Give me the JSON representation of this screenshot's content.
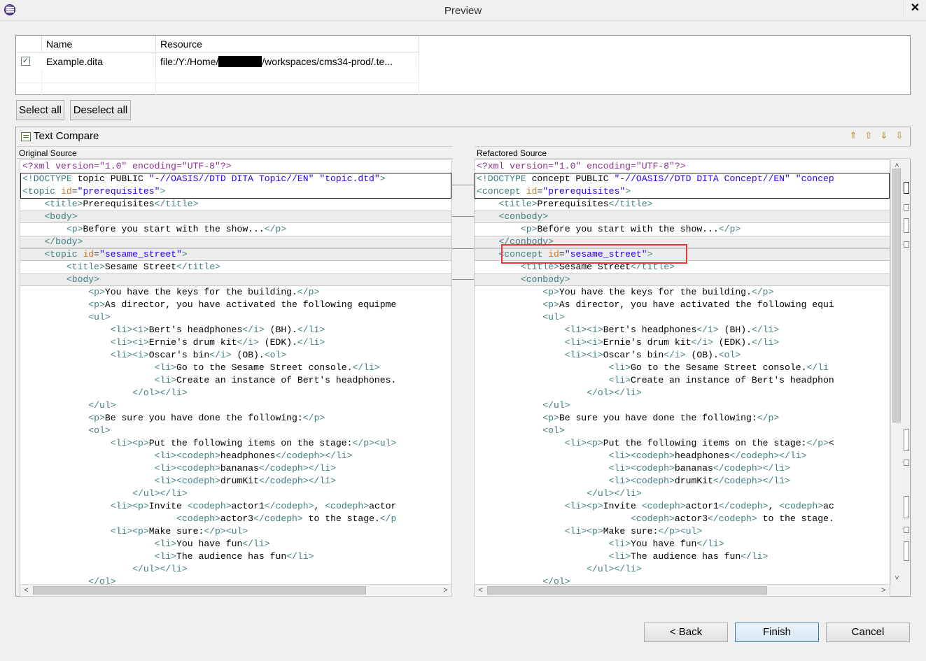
{
  "window": {
    "title": "Preview",
    "close_glyph": "✕"
  },
  "table": {
    "headers": {
      "name": "Name",
      "resource": "Resource"
    },
    "rows": [
      {
        "checked": true,
        "name": "Example.dita",
        "resource_prefix": "file:/Y:/Home/",
        "resource_suffix": "/workspaces/cms34-prod/.te..."
      }
    ]
  },
  "buttons": {
    "select_all": "Select all",
    "deselect_all": "Deselect all",
    "back": "< Back",
    "finish": "Finish",
    "cancel": "Cancel"
  },
  "compare": {
    "title": "Text Compare",
    "left_header": "Original Source",
    "right_header": "Refactored Source",
    "toolbar_icons": [
      "copy-all-left-to-right-icon",
      "copy-all-right-to-left-icon",
      "next-difference-icon",
      "previous-difference-icon"
    ]
  },
  "left_lines": [
    "<?xml version=\"1.0\" encoding=\"UTF-8\"?>",
    "<!DOCTYPE topic PUBLIC \"-//OASIS//DTD DITA Topic//EN\" \"topic.dtd\">",
    "<topic id=\"prerequisites\">",
    "    <title>Prerequisites</title>",
    "    <body>",
    "        <p>Before you start with the show...</p>",
    "    </body>",
    "    <topic id=\"sesame_street\">",
    "        <title>Sesame Street</title>",
    "        <body>",
    "            <p>You have the keys for the building.</p>",
    "            <p>As director, you have activated the following equipme",
    "            <ul>",
    "                <li><i>Bert's headphones</i> (BH).</li>",
    "                <li><i>Ernie's drum kit</i> (EDK).</li>",
    "                <li><i>Oscar's bin</i> (OB).<ol>",
    "                        <li>Go to the Sesame Street console.</li>",
    "                        <li>Create an instance of Bert's headphones.",
    "                    </ol></li>",
    "            </ul>",
    "            <p>Be sure you have done the following:</p>",
    "            <ol>",
    "                <li><p>Put the following items on the stage:</p><ul>",
    "                        <li><codeph>headphones</codeph></li>",
    "                        <li><codeph>bananas</codeph></li>",
    "                        <li><codeph>drumKit</codeph></li>",
    "                    </ul></li>",
    "                <li><p>Invite <codeph>actor1</codeph>, <codeph>actor",
    "                            <codeph>actor3</codeph> to the stage.</p",
    "                <li><p>Make sure:</p><ul>",
    "                        <li>You have fun</li>",
    "                        <li>The audience has fun</li>",
    "                    </ul></li>",
    "            </ol>"
  ],
  "right_lines": [
    "<?xml version=\"1.0\" encoding=\"UTF-8\"?>",
    "<!DOCTYPE concept PUBLIC \"-//OASIS//DTD DITA Concept//EN\" \"concep",
    "<concept id=\"prerequisites\">",
    "    <title>Prerequisites</title>",
    "    <conbody>",
    "        <p>Before you start with the show...</p>",
    "    </conbody>",
    "    <concept id=\"sesame_street\">",
    "        <title>Sesame Street</title>",
    "        <conbody>",
    "            <p>You have the keys for the building.</p>",
    "            <p>As director, you have activated the following equi",
    "            <ul>",
    "                <li><i>Bert's headphones</i> (BH).</li>",
    "                <li><i>Ernie's drum kit</i> (EDK).</li>",
    "                <li><i>Oscar's bin</i> (OB).<ol>",
    "                        <li>Go to the Sesame Street console.</li",
    "                        <li>Create an instance of Bert's headphon",
    "                    </ol></li>",
    "            </ul>",
    "            <p>Be sure you have done the following:</p>",
    "            <ol>",
    "                <li><p>Put the following items on the stage:</p><",
    "                        <li><codeph>headphones</codeph></li>",
    "                        <li><codeph>bananas</codeph></li>",
    "                        <li><codeph>drumKit</codeph></li>",
    "                    </ul></li>",
    "                <li><p>Invite <codeph>actor1</codeph>, <codeph>ac",
    "                            <codeph>actor3</codeph> to the stage.",
    "                <li><p>Make sure:</p><ul>",
    "                        <li>You have fun</li>",
    "                        <li>The audience has fun</li>",
    "                    </ul></li>",
    "            </ol>"
  ],
  "diff": {
    "boxed_lines": [
      1,
      2
    ],
    "changed_lines": [
      4,
      6,
      7,
      9
    ],
    "highlighted_line_right": 7
  }
}
